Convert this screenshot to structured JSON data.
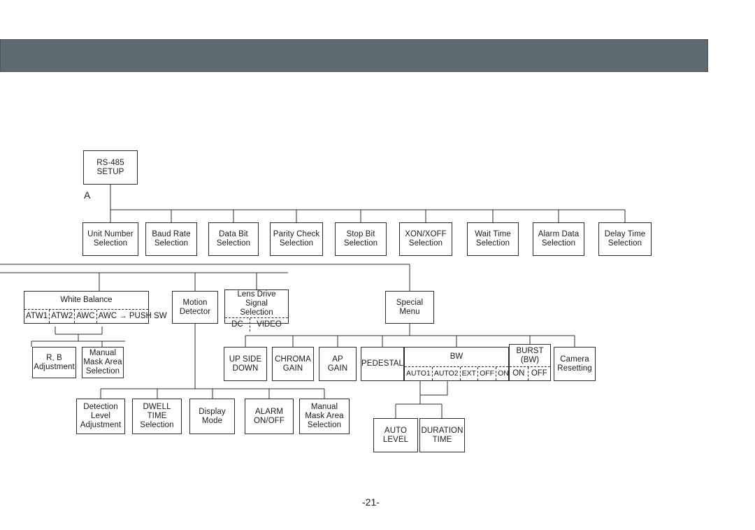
{
  "page": {
    "number_label": "-21-",
    "header_band_color": "#5d6b70",
    "background_color": "#ffffff",
    "line_color": "#2b2b2b"
  },
  "diagram": {
    "type": "tree-flowchart",
    "branch_label": "A",
    "root": {
      "id": "rs485-setup",
      "lines": [
        "RS-485",
        "SETUP"
      ]
    },
    "rs485_children": [
      {
        "id": "unit-number-selection",
        "lines": [
          "Unit Number",
          "Selection"
        ]
      },
      {
        "id": "baud-rate-selection",
        "lines": [
          "Baud Rate",
          "Selection"
        ]
      },
      {
        "id": "data-bit-selection",
        "lines": [
          "Data Bit",
          "Selection"
        ]
      },
      {
        "id": "parity-check-selection",
        "lines": [
          "Parity Check",
          "Selection"
        ]
      },
      {
        "id": "stop-bit-selection",
        "lines": [
          "Stop Bit",
          "Selection"
        ]
      },
      {
        "id": "xon-xoff-selection",
        "lines": [
          "XON/XOFF",
          "Selection"
        ]
      },
      {
        "id": "wait-time-selection",
        "lines": [
          "Wait Time",
          "Selection"
        ]
      },
      {
        "id": "alarm-data-selection",
        "lines": [
          "Alarm Data",
          "Selection"
        ]
      },
      {
        "id": "delay-time-selection",
        "lines": [
          "Delay Time",
          "Selection"
        ]
      }
    ],
    "white_balance": {
      "title": [
        "White Balance"
      ],
      "options": [
        "ATW1",
        "ATW2",
        "AWC",
        "AWC → PUSH SW"
      ]
    },
    "motion_detector": {
      "lines": [
        "Motion",
        "Detector"
      ]
    },
    "lens_drive": {
      "title": [
        "Lens Drive Signal",
        "Selection"
      ],
      "options": [
        "DC",
        "VIDEO"
      ]
    },
    "special_menu": {
      "lines": [
        "Special",
        "Menu"
      ]
    },
    "white_balance_children": [
      {
        "id": "rb-adjustment",
        "lines": [
          "R, B",
          "Adjustment"
        ]
      },
      {
        "id": "manual-mask-area-selection-wb",
        "lines": [
          "Manual",
          "Mask Area",
          "Selection"
        ]
      }
    ],
    "special_menu_children": [
      {
        "id": "up-side-down",
        "lines": [
          "UP SIDE",
          "DOWN"
        ]
      },
      {
        "id": "chroma-gain",
        "lines": [
          "CHROMA",
          "GAIN"
        ]
      },
      {
        "id": "ap-gain",
        "lines": [
          "AP",
          "GAIN"
        ]
      },
      {
        "id": "pedestal",
        "lines": [
          "PEDESTAL"
        ]
      }
    ],
    "bw": {
      "title": [
        "BW"
      ],
      "options": [
        "AUTO1",
        "AUTO2",
        "EXT",
        "OFF",
        "ON"
      ]
    },
    "burst_bw": {
      "title": [
        "BURST",
        "(BW)"
      ],
      "options": [
        "ON",
        "OFF"
      ]
    },
    "camera_resetting": {
      "lines": [
        "Camera",
        "Resetting"
      ]
    },
    "motion_detector_children": [
      {
        "id": "detection-level-adjustment",
        "lines": [
          "Detection",
          "Level",
          "Adjustment"
        ]
      },
      {
        "id": "dwell-time-selection",
        "lines": [
          "DWELL",
          "TIME",
          "Selection"
        ]
      },
      {
        "id": "display-mode",
        "lines": [
          "Display",
          "Mode"
        ]
      },
      {
        "id": "alarm-on-off",
        "lines": [
          "ALARM",
          "ON/OFF"
        ]
      },
      {
        "id": "manual-mask-area-selection-md",
        "lines": [
          "Manual",
          "Mask Area",
          "Selection"
        ]
      }
    ],
    "bw_children": [
      {
        "id": "auto-level",
        "lines": [
          "AUTO",
          "LEVEL"
        ]
      },
      {
        "id": "duration-time",
        "lines": [
          "DURATION",
          "TIME"
        ]
      }
    ]
  }
}
